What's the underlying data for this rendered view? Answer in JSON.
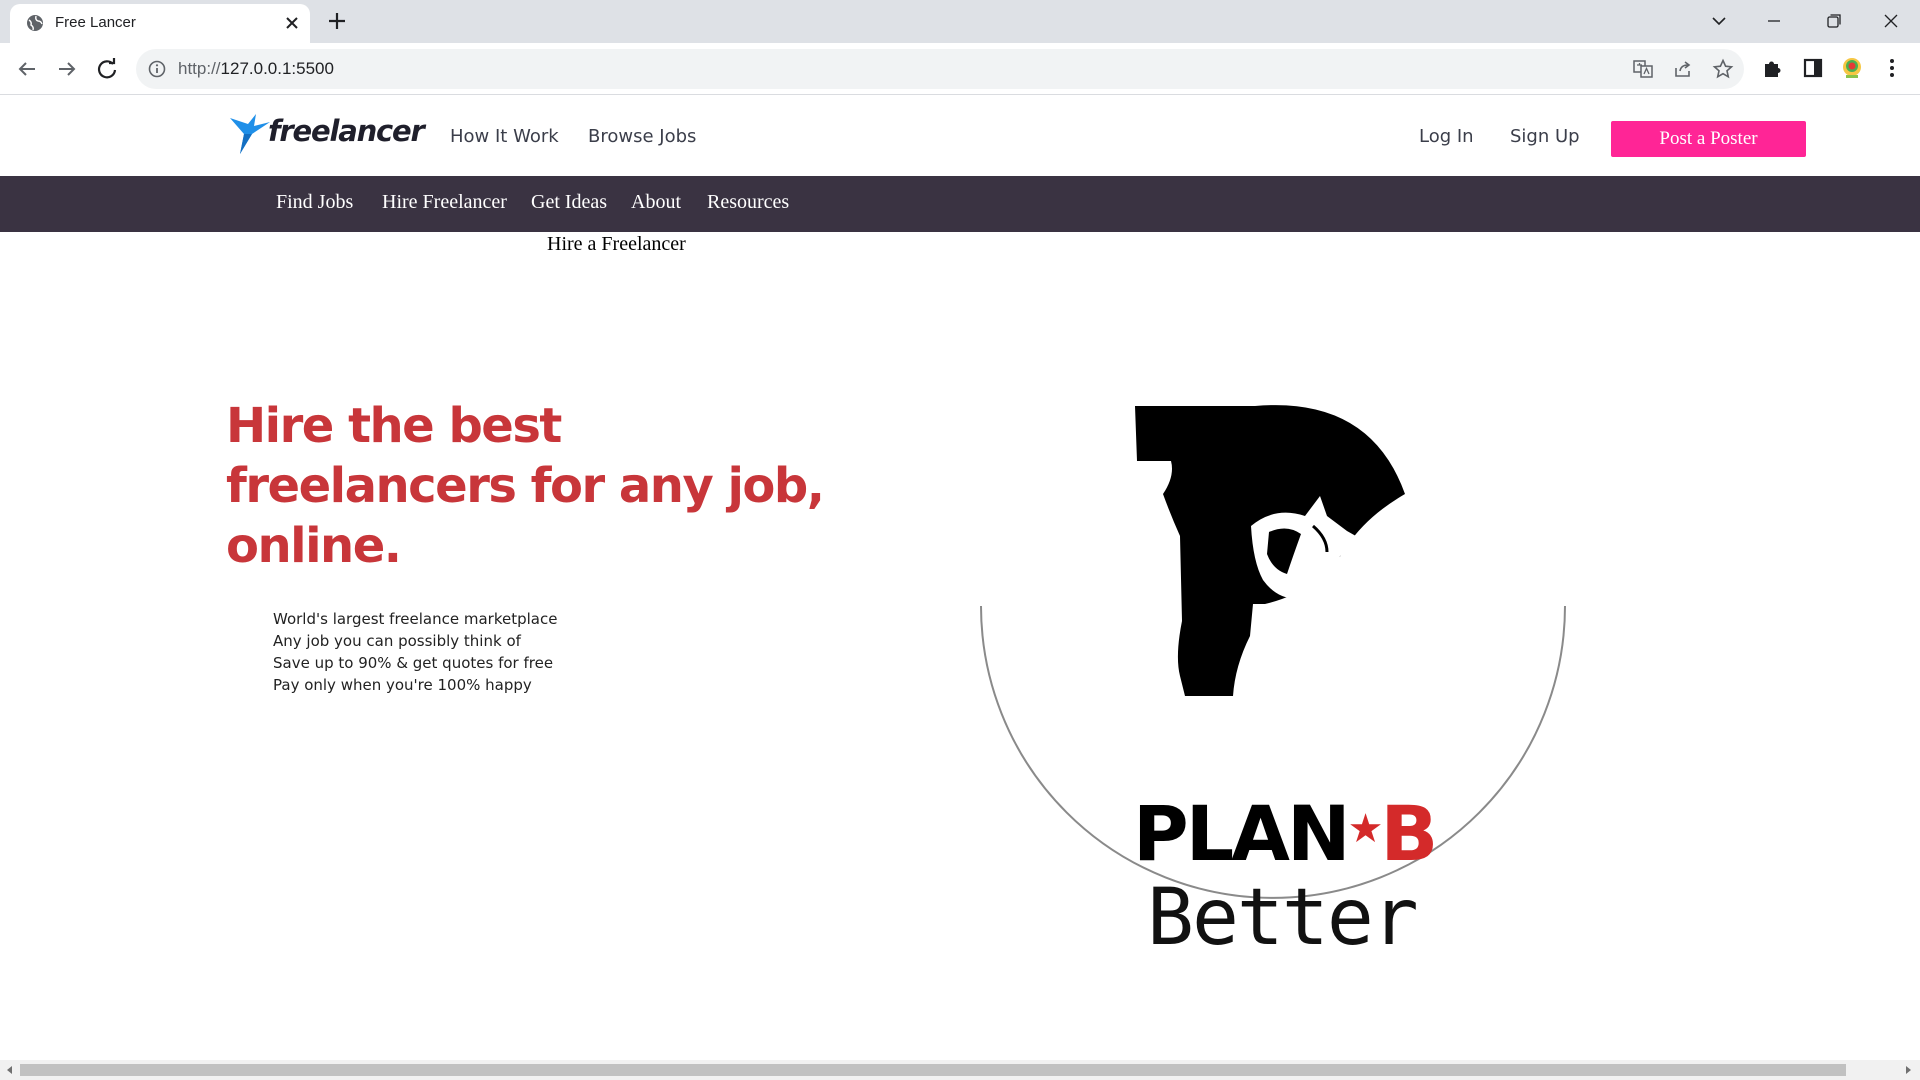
{
  "browser": {
    "tab_title": "Free Lancer",
    "url_scheme": "http://",
    "url_host": "127.0.0.1:5500"
  },
  "header": {
    "logo_text": "freelancer",
    "links": [
      "How It Work",
      "Browse Jobs"
    ],
    "login": "Log In",
    "signup": "Sign Up",
    "post_button": "Post a Poster"
  },
  "nav": {
    "items": [
      "Find Jobs",
      "Hire Freelancer",
      "Get Ideas",
      "About",
      "Resources"
    ],
    "dropdown_item": "Hire a Freelancer"
  },
  "hero": {
    "title_lines": [
      "Hire the best",
      "freelancers for any job,",
      "online."
    ],
    "points": [
      "World's largest freelance marketplace",
      "Any job you can possibly think of",
      "Save up to 90% & get quotes for free",
      "Pay only when you're 100% happy"
    ]
  },
  "brand_image": {
    "word_plan": "PLAN",
    "word_star": "★",
    "word_b": "B",
    "word_better": "Better"
  },
  "colors": {
    "accent_pink": "#ff2596",
    "nav_bg": "#3a3342",
    "hero_red": "#c8363a",
    "logo_blue": "#1f8fe8"
  }
}
